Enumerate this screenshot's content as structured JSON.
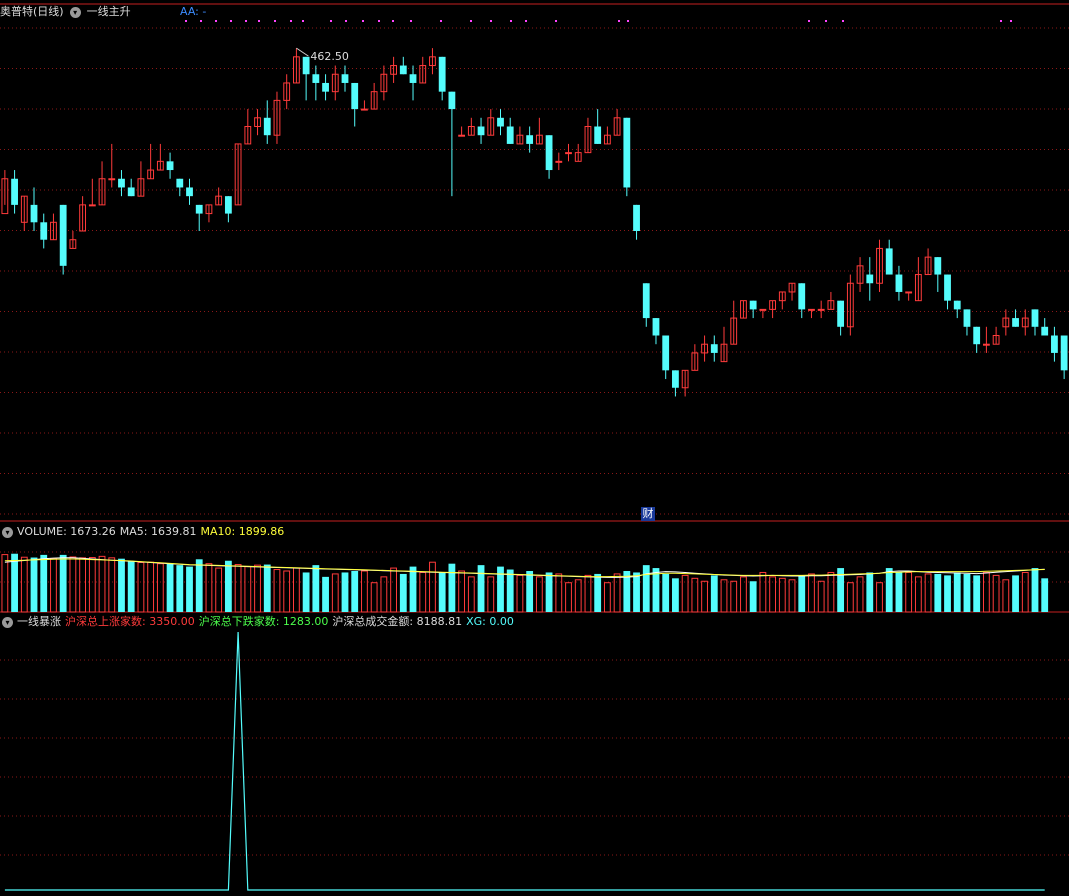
{
  "main_header": {
    "title": "奥普特(日线)",
    "indicator": "一线主升",
    "aa_label": "AA: -"
  },
  "volume_header": {
    "label": "VOLUME: 1673.26",
    "ma5": "MA5: 1639.81",
    "ma10": "MA10: 1899.86"
  },
  "sub_header": {
    "title": "一线暴涨",
    "up": "沪深总上涨家数: 3350.00",
    "down": "沪深总下跌家数: 1283.00",
    "amount": "沪深总成交金额: 8188.81",
    "xg": "XG: 0.00"
  },
  "marker": "财",
  "high_label": "462.50",
  "colors": {
    "up": "#ff3b3b",
    "down": "#54fcfc",
    "grid": "#8a1818",
    "ma5": "#ffffff",
    "ma10": "#ffff3a",
    "signal": "#54fcfc"
  },
  "chart_data": [
    {
      "type": "candlestick",
      "title": "奥普特(日线)",
      "annotation": "462.50",
      "candles": [
        [
          384,
          388,
          385,
          389
        ],
        [
          388,
          385,
          384,
          389
        ],
        [
          383,
          386,
          382,
          386
        ],
        [
          385,
          383,
          382,
          387
        ],
        [
          383,
          381,
          380,
          384
        ],
        [
          381,
          383,
          381,
          384
        ],
        [
          385,
          378,
          377,
          385
        ],
        [
          380,
          381,
          380,
          382
        ],
        [
          382,
          385,
          382,
          386
        ],
        [
          385,
          385,
          385,
          388
        ],
        [
          385,
          388,
          385,
          390
        ],
        [
          388,
          388,
          387,
          392
        ],
        [
          388,
          387,
          386,
          389
        ],
        [
          387,
          386,
          386,
          388
        ],
        [
          386,
          388,
          386,
          390
        ],
        [
          388,
          389,
          388,
          392
        ],
        [
          389,
          390,
          389,
          392
        ],
        [
          390,
          389,
          388,
          391
        ],
        [
          388,
          387,
          386,
          388
        ],
        [
          387,
          386,
          385,
          388
        ],
        [
          385,
          384,
          382,
          385
        ],
        [
          384,
          385,
          383,
          385
        ],
        [
          385,
          386,
          385,
          387
        ],
        [
          386,
          384,
          383,
          386
        ],
        [
          385,
          392,
          385,
          392
        ],
        [
          392,
          394,
          392,
          396
        ],
        [
          394,
          395,
          393,
          396
        ],
        [
          395,
          393,
          392,
          397
        ],
        [
          393,
          397,
          392,
          398
        ],
        [
          397,
          399,
          396,
          400
        ],
        [
          399,
          402,
          399,
          403
        ],
        [
          402,
          400,
          397,
          402
        ],
        [
          400,
          399,
          397,
          401
        ],
        [
          399,
          398,
          397,
          400
        ],
        [
          398,
          400,
          397,
          401
        ],
        [
          400,
          399,
          398,
          401
        ],
        [
          399,
          396,
          394,
          399
        ],
        [
          396,
          396,
          396,
          397
        ],
        [
          396,
          398,
          396,
          399
        ],
        [
          398,
          400,
          397,
          401
        ],
        [
          400,
          401,
          399,
          402
        ],
        [
          401,
          400,
          400,
          402
        ],
        [
          400,
          399,
          397,
          401
        ],
        [
          399,
          401,
          399,
          402
        ],
        [
          401,
          402,
          400,
          403
        ],
        [
          402,
          398,
          397,
          402
        ],
        [
          398,
          396,
          386,
          398
        ],
        [
          393,
          393,
          393,
          394
        ],
        [
          393,
          394,
          393,
          395
        ],
        [
          394,
          393,
          392,
          395
        ],
        [
          393,
          395,
          393,
          396
        ],
        [
          395,
          394,
          393,
          396
        ],
        [
          394,
          392,
          392,
          395
        ],
        [
          392,
          393,
          392,
          394
        ],
        [
          393,
          392,
          391,
          394
        ],
        [
          392,
          393,
          392,
          395
        ],
        [
          393,
          389,
          388,
          393
        ],
        [
          390,
          390,
          389,
          391
        ],
        [
          391,
          391,
          390,
          392
        ],
        [
          390,
          391,
          390,
          392
        ],
        [
          391,
          394,
          391,
          395
        ],
        [
          394,
          392,
          392,
          396
        ],
        [
          392,
          393,
          392,
          394
        ],
        [
          393,
          395,
          393,
          396
        ],
        [
          395,
          387,
          386,
          395
        ],
        [
          385,
          382,
          381,
          385
        ],
        [
          376,
          372,
          371,
          376
        ],
        [
          372,
          370,
          369,
          372
        ],
        [
          370,
          366,
          365,
          370
        ],
        [
          366,
          364,
          363,
          366
        ],
        [
          364,
          366,
          363,
          366
        ],
        [
          366,
          368,
          366,
          369
        ],
        [
          368,
          369,
          367,
          370
        ],
        [
          369,
          368,
          367,
          370
        ],
        [
          367,
          369,
          367,
          371
        ],
        [
          369,
          372,
          369,
          374
        ],
        [
          372,
          374,
          372,
          374
        ],
        [
          374,
          373,
          372,
          374
        ],
        [
          373,
          373,
          372,
          373
        ],
        [
          373,
          374,
          372,
          374
        ],
        [
          374,
          375,
          373,
          375
        ],
        [
          375,
          376,
          374,
          376
        ],
        [
          376,
          373,
          372,
          376
        ],
        [
          373,
          373,
          372,
          373
        ],
        [
          373,
          373,
          372,
          374
        ],
        [
          373,
          374,
          373,
          375
        ],
        [
          374,
          371,
          370,
          374
        ],
        [
          371,
          376,
          370,
          377
        ],
        [
          376,
          378,
          375,
          379
        ],
        [
          377,
          376,
          374,
          379
        ],
        [
          376,
          380,
          375,
          381
        ],
        [
          380,
          377,
          377,
          381
        ],
        [
          377,
          375,
          374,
          378
        ],
        [
          375,
          375,
          374,
          375
        ],
        [
          374,
          377,
          374,
          379
        ],
        [
          377,
          379,
          377,
          380
        ],
        [
          379,
          377,
          375,
          379
        ],
        [
          377,
          374,
          373,
          377
        ],
        [
          374,
          373,
          372,
          374
        ],
        [
          373,
          371,
          370,
          373
        ],
        [
          371,
          369,
          368,
          371
        ],
        [
          369,
          369,
          368,
          371
        ],
        [
          369,
          370,
          369,
          371
        ],
        [
          371,
          372,
          370,
          373
        ],
        [
          372,
          371,
          371,
          373
        ],
        [
          371,
          372,
          370,
          373
        ],
        [
          373,
          371,
          370,
          373
        ],
        [
          371,
          370,
          370,
          372
        ],
        [
          370,
          368,
          367,
          371
        ],
        [
          370,
          366,
          365,
          370
        ]
      ]
    },
    {
      "type": "bar",
      "title": "VOLUME",
      "series": [
        {
          "name": "VOLUME",
          "values": [
            1960,
            1990,
            1870,
            1860,
            1950,
            1820,
            1950,
            1880,
            1850,
            1860,
            1900,
            1850,
            1820,
            1740,
            1690,
            1700,
            1650,
            1650,
            1600,
            1550,
            1800,
            1650,
            1500,
            1750,
            1620,
            1550,
            1600,
            1620,
            1450,
            1400,
            1500,
            1350,
            1600,
            1200,
            1300,
            1350,
            1400,
            1400,
            1000,
            1200,
            1500,
            1300,
            1550,
            1350,
            1700,
            1350,
            1650,
            1400,
            1200,
            1600,
            1200,
            1550,
            1450,
            1250,
            1400,
            1200,
            1350,
            1300,
            1000,
            1100,
            1250,
            1300,
            1000,
            1300,
            1400,
            1350,
            1600,
            1500,
            1300,
            1150,
            1250,
            1150,
            1050,
            1250,
            1100,
            1050,
            1200,
            1050,
            1350,
            1200,
            1150,
            1100,
            1250,
            1300,
            1050,
            1350,
            1500,
            1000,
            1200,
            1350,
            1000,
            1500,
            1350,
            1350,
            1200,
            1300,
            1300,
            1250,
            1350,
            1300,
            1250,
            1350,
            1250,
            1100,
            1250,
            1350,
            1500,
            1150
          ]
        },
        {
          "name": "MA5",
          "values": [
            1700,
            1730,
            1760,
            1790,
            1820,
            1840,
            1850,
            1850,
            1830,
            1810,
            1790,
            1770,
            1750,
            1730,
            1710,
            1690,
            1670,
            1650,
            1630,
            1610,
            1600,
            1590,
            1580,
            1570,
            1560,
            1550,
            1540,
            1530,
            1520,
            1510,
            1500,
            1490,
            1480,
            1470,
            1460,
            1450,
            1440,
            1430,
            1420,
            1410,
            1400,
            1390,
            1380,
            1370,
            1360,
            1350,
            1340,
            1330,
            1320,
            1310,
            1300,
            1290,
            1280,
            1270,
            1260,
            1250,
            1240,
            1230,
            1220,
            1210,
            1200,
            1190,
            1180,
            1180,
            1190,
            1210,
            1300,
            1350,
            1380,
            1370,
            1350,
            1320,
            1300,
            1280,
            1260,
            1250,
            1240,
            1230,
            1240,
            1250,
            1240,
            1230,
            1230,
            1240,
            1240,
            1250,
            1260,
            1270,
            1280,
            1300,
            1320,
            1380,
            1400,
            1400,
            1380,
            1360,
            1350,
            1340,
            1330,
            1320,
            1310,
            1330,
            1360,
            1380,
            1400,
            1420,
            1440,
            1460
          ]
        },
        {
          "name": "MA10",
          "values": [
            1750,
            1760,
            1770,
            1780,
            1790,
            1800,
            1810,
            1810,
            1800,
            1790,
            1780,
            1770,
            1760,
            1740,
            1720,
            1700,
            1680,
            1660,
            1640,
            1620,
            1610,
            1600,
            1590,
            1580,
            1570,
            1560,
            1550,
            1540,
            1530,
            1520,
            1510,
            1500,
            1490,
            1480,
            1470,
            1460,
            1450,
            1440,
            1430,
            1420,
            1410,
            1400,
            1390,
            1380,
            1370,
            1360,
            1350,
            1340,
            1330,
            1320,
            1310,
            1300,
            1290,
            1280,
            1270,
            1260,
            1250,
            1240,
            1230,
            1220,
            1210,
            1210,
            1210,
            1215,
            1220,
            1240,
            1280,
            1300,
            1320,
            1320,
            1310,
            1300,
            1290,
            1280,
            1270,
            1260,
            1250,
            1250,
            1250,
            1250,
            1250,
            1250,
            1250,
            1260,
            1260,
            1270,
            1280,
            1290,
            1300,
            1310,
            1320,
            1350,
            1360,
            1370,
            1380,
            1380,
            1380,
            1380,
            1380,
            1380,
            1380,
            1390,
            1400,
            1410,
            1420,
            1430,
            1440,
            1450
          ]
        }
      ]
    },
    {
      "type": "line",
      "title": "一线暴涨",
      "series": [
        {
          "name": "XG",
          "values": [
            0,
            0,
            0,
            0,
            0,
            0,
            0,
            0,
            0,
            0,
            0,
            0,
            0,
            0,
            0,
            0,
            0,
            0,
            0,
            0,
            0,
            0,
            0,
            0,
            1,
            0,
            0,
            0,
            0,
            0,
            0,
            0,
            0,
            0,
            0,
            0,
            0,
            0,
            0,
            0,
            0,
            0,
            0,
            0,
            0,
            0,
            0,
            0,
            0,
            0,
            0,
            0,
            0,
            0,
            0,
            0,
            0,
            0,
            0,
            0,
            0,
            0,
            0,
            0,
            0,
            0,
            0,
            0,
            0,
            0,
            0,
            0,
            0,
            0,
            0,
            0,
            0,
            0,
            0,
            0,
            0,
            0,
            0,
            0,
            0,
            0,
            0,
            0,
            0,
            0,
            0,
            0,
            0,
            0,
            0,
            0,
            0,
            0,
            0,
            0,
            0,
            0,
            0,
            0,
            0,
            0,
            0,
            0
          ]
        }
      ]
    }
  ]
}
